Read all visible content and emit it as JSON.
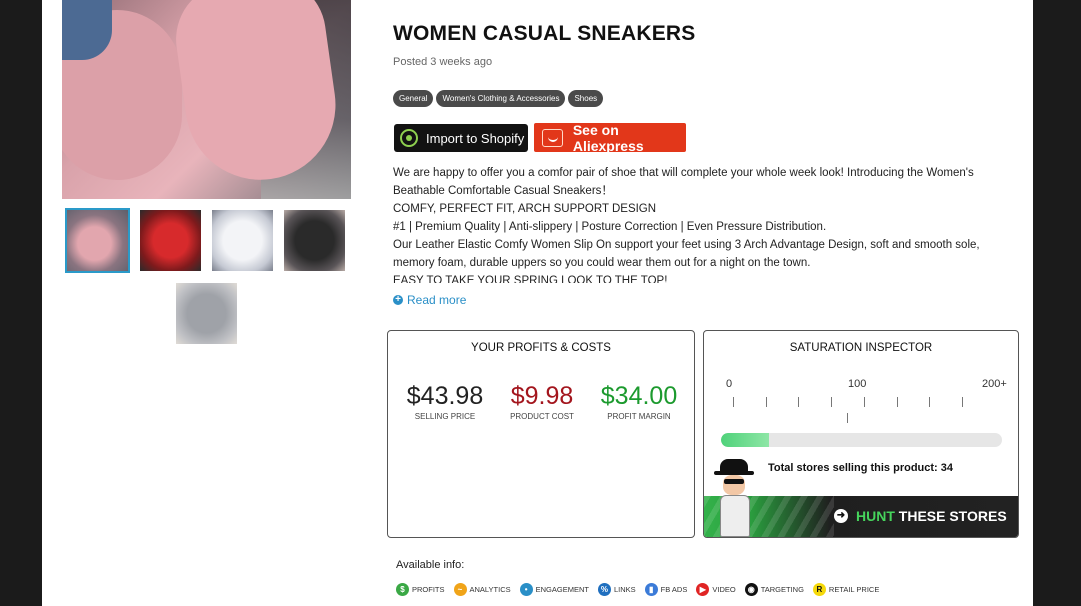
{
  "product": {
    "title": "WOMEN CASUAL SNEAKERS",
    "posted": "Posted 3 weeks ago",
    "tags": [
      "General",
      "Women's Clothing & Accessories",
      "Shoes"
    ]
  },
  "actions": {
    "shopify_label": "Import to Shopify",
    "aliexpress_label": "See on Aliexpress"
  },
  "description": {
    "lines": [
      "We are happy to offer you a comfor pair of shoe that will complete your whole week look! Introducing the Women's",
      "Beathable Comfortable Casual Sneakers！",
      "COMFY, PERFECT FIT, ARCH SUPPORT DESIGN",
      "#1 | Premium Quality | Anti-slippery | Posture Correction | Even Pressure Distribution.",
      "Our Leather Elastic Comfy Women Slip On support your feet using 3 Arch Advantage Design, soft and smooth sole,",
      "memory foam, durable uppers so you could wear them out for a night on the town.",
      "EASY TO TAKE YOUR SPRING LOOK TO THE TOP!"
    ],
    "read_more": "Read more"
  },
  "gallery": {
    "thumbnails": [
      "thumb-pink-sneaker",
      "thumb-red-sneaker",
      "thumb-white-sneaker",
      "thumb-black-sneaker",
      "thumb-grey-sneaker"
    ],
    "selected_index": 0
  },
  "profits": {
    "heading": "YOUR PROFITS & COSTS",
    "selling_price": {
      "value": "$43.98",
      "label": "SELLING PRICE"
    },
    "product_cost": {
      "value": "$9.98",
      "label": "PRODUCT COST"
    },
    "profit_margin": {
      "value": "$34.00",
      "label": "PROFIT MARGIN"
    }
  },
  "saturation": {
    "heading": "SATURATION INSPECTOR",
    "scale_min": "0",
    "scale_mid": "100",
    "scale_max": "200+",
    "fill_percent": 17,
    "stores_text": "Total stores selling this product: 34",
    "cta_green": "HUNT",
    "cta_white": "THESE STORES"
  },
  "available_info": {
    "label": "Available info:",
    "items": [
      {
        "label": "PROFITS",
        "color": "#3aa845",
        "glyph": "$"
      },
      {
        "label": "ANALYTICS",
        "color": "#f0a419",
        "glyph": "~"
      },
      {
        "label": "ENGAGEMENT",
        "color": "#2a8fc7",
        "glyph": "•"
      },
      {
        "label": "LINKS",
        "color": "#1f6fbf",
        "glyph": "%"
      },
      {
        "label": "FB ADS",
        "color": "#3b7bd8",
        "glyph": "▮"
      },
      {
        "label": "VIDEO",
        "color": "#e02424",
        "glyph": "▶"
      },
      {
        "label": "TARGETING",
        "color": "#111111",
        "glyph": "◉"
      },
      {
        "label": "RETAIL PRICE",
        "color": "#f5d90a",
        "glyph": "R"
      }
    ]
  }
}
